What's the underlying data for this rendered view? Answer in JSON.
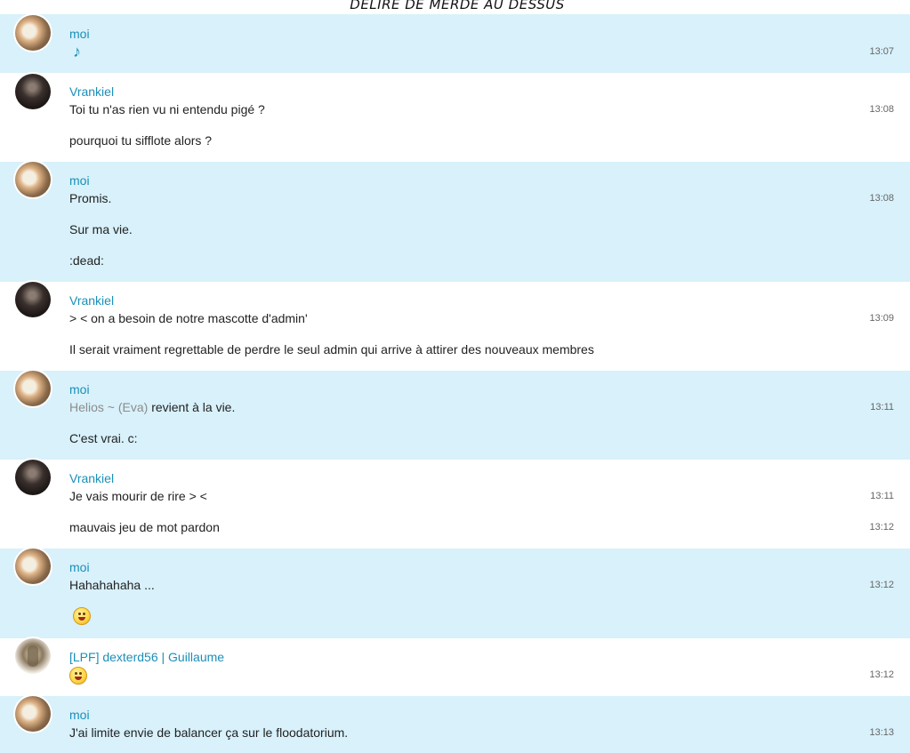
{
  "header": {
    "title": "DÉLIRE DE MERDE AU DESSUS"
  },
  "messages": [
    {
      "sender": "moi",
      "avatar": "avatar-moi",
      "lines": [
        {
          "kind": "icon",
          "icon": "music-note-icon",
          "glyph": "♪",
          "time": "13:07"
        }
      ]
    },
    {
      "sender": "Vrankiel",
      "avatar": "avatar-vrankiel",
      "lines": [
        {
          "text": "Toi tu n'as rien vu ni entendu pigé ?",
          "time": "13:08"
        },
        {
          "text": "pourquoi tu sifflote alors ?",
          "time": ""
        }
      ]
    },
    {
      "sender": "moi",
      "avatar": "avatar-moi",
      "lines": [
        {
          "text": "Promis.",
          "time": "13:08"
        },
        {
          "text": "Sur ma vie.",
          "time": ""
        },
        {
          "text": ":dead:",
          "time": ""
        }
      ]
    },
    {
      "sender": "Vrankiel",
      "avatar": "avatar-vrankiel",
      "lines": [
        {
          "text": "> < on a besoin de notre mascotte d'admin'",
          "time": "13:09"
        },
        {
          "text": "Il serait vraiment regrettable de perdre le seul admin qui arrive à attirer des nouveaux membres",
          "time": ""
        }
      ]
    },
    {
      "sender": "moi",
      "avatar": "avatar-moi",
      "lines": [
        {
          "mention": "Helios ~ (Eva)",
          "text": " revient à la vie.",
          "time": "13:11"
        },
        {
          "text": "C'est vrai. c:",
          "time": ""
        }
      ]
    },
    {
      "sender": "Vrankiel",
      "avatar": "avatar-vrankiel",
      "lines": [
        {
          "text": "Je vais mourir de rire > <",
          "time": "13:11"
        },
        {
          "text": "mauvais jeu de mot pardon",
          "time": "13:12"
        }
      ]
    },
    {
      "sender": "moi",
      "avatar": "avatar-moi",
      "lines": [
        {
          "text": "Hahahahaha ...",
          "time": "13:12"
        },
        {
          "kind": "emoji",
          "emoji": "laughing-emoji-icon",
          "time": ""
        }
      ]
    },
    {
      "sender": "[LPF] dexterd56 | Guillaume",
      "avatar": "avatar-dexterd",
      "lines": [
        {
          "kind": "emoji",
          "emoji": "laughing-emoji-icon",
          "time": "13:12"
        }
      ]
    },
    {
      "sender": "moi",
      "avatar": "avatar-moi",
      "lines": [
        {
          "text": "J'ai limite envie de balancer ça sur le floodatorium.",
          "time": "13:13"
        }
      ]
    }
  ]
}
